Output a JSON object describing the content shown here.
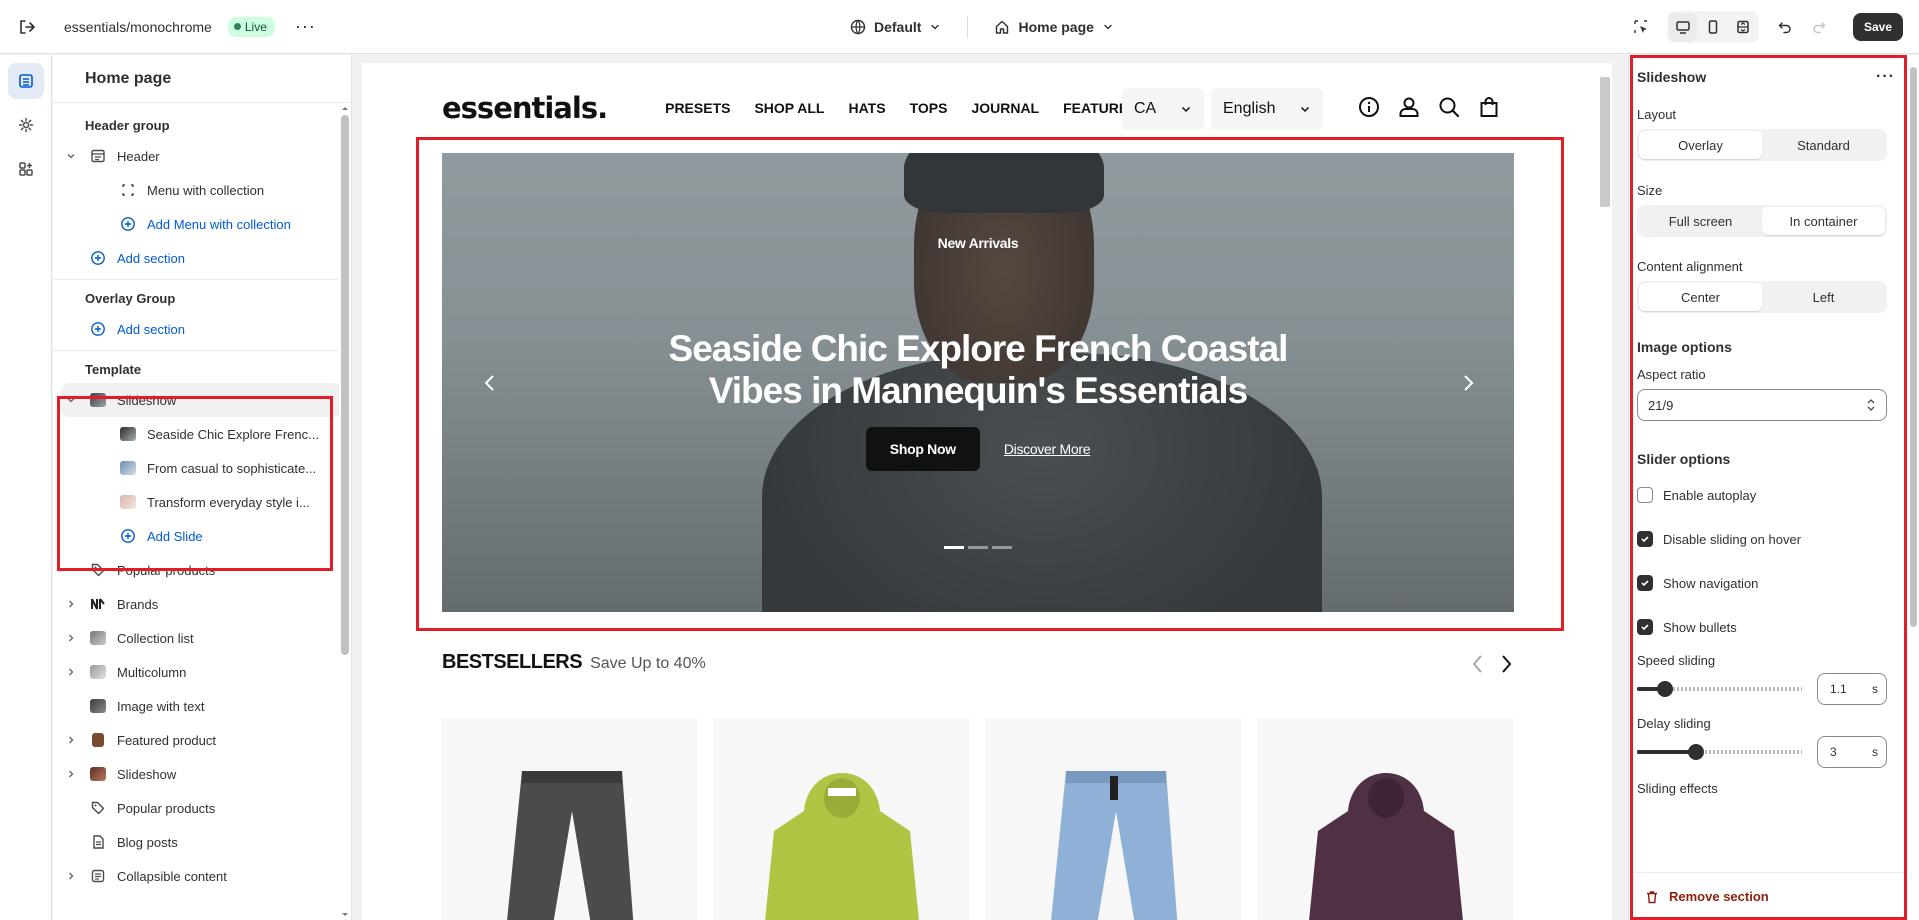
{
  "topbar": {
    "store_name": "essentials/monochrome",
    "status_badge": "Live",
    "theme_select": "Default",
    "page_select": "Home page",
    "save_label": "Save"
  },
  "sidebar": {
    "title": "Home page",
    "header_group": {
      "heading": "Header group",
      "header_label": "Header",
      "menu_label": "Menu with collection",
      "add_menu_label": "Add Menu with collection",
      "add_section_label": "Add section"
    },
    "overlay_group": {
      "heading": "Overlay Group",
      "add_section_label": "Add section"
    },
    "template": {
      "heading": "Template",
      "slideshow_label": "Slideshow",
      "slides": [
        "Seaside Chic Explore Frenc...",
        "From casual to sophisticate...",
        "Transform everyday style i..."
      ],
      "add_slide_label": "Add Slide",
      "sections": [
        "Popular products",
        "Brands",
        "Collection list",
        "Multicolumn",
        "Image with text",
        "Featured product",
        "Slideshow",
        "Popular products",
        "Blog posts",
        "Collapsible content"
      ]
    }
  },
  "preview": {
    "logo": "essentials.",
    "nav": [
      "PRESETS",
      "SHOP ALL",
      "HATS",
      "TOPS",
      "JOURNAL",
      "FEATURES"
    ],
    "country": "CA",
    "language": "English",
    "hero": {
      "subheading": "New Arrivals",
      "title_line1": "Seaside Chic Explore French Coastal",
      "title_line2": "Vibes in Mannequin's Essentials",
      "primary_button": "Shop Now",
      "secondary_button": "Discover More"
    },
    "bestsellers": {
      "title": "BESTSELLERS",
      "subtitle": "Save Up to 40%"
    },
    "products": [
      {
        "name": "grey-jeans",
        "color": "#4b4b4b"
      },
      {
        "name": "green-hoodie",
        "color": "#b2c444"
      },
      {
        "name": "blue-jeans",
        "color": "#8fb1d8"
      },
      {
        "name": "purple-hoodie",
        "color": "#4f3045"
      }
    ]
  },
  "settings": {
    "title": "Slideshow",
    "layout": {
      "label": "Layout",
      "options": [
        "Overlay",
        "Standard"
      ],
      "selected": "Overlay"
    },
    "size": {
      "label": "Size",
      "options": [
        "Full screen",
        "In container"
      ],
      "selected": "In container"
    },
    "alignment": {
      "label": "Content alignment",
      "options": [
        "Center",
        "Left"
      ],
      "selected": "Center"
    },
    "image_options": {
      "heading": "Image options",
      "aspect_label": "Aspect ratio",
      "aspect_value": "21/9"
    },
    "slider_options": {
      "heading": "Slider options",
      "autoplay": {
        "label": "Enable autoplay",
        "checked": false
      },
      "disable_hover": {
        "label": "Disable sliding on hover",
        "checked": true
      },
      "show_nav": {
        "label": "Show navigation",
        "checked": true
      },
      "show_bullets": {
        "label": "Show bullets",
        "checked": true
      },
      "speed": {
        "label": "Speed sliding",
        "value": "1.1",
        "unit": "s",
        "fraction": 0.17
      },
      "delay": {
        "label": "Delay sliding",
        "value": "3",
        "unit": "s",
        "fraction": 0.36
      },
      "effects_label": "Sliding effects"
    },
    "remove_label": "Remove section"
  }
}
